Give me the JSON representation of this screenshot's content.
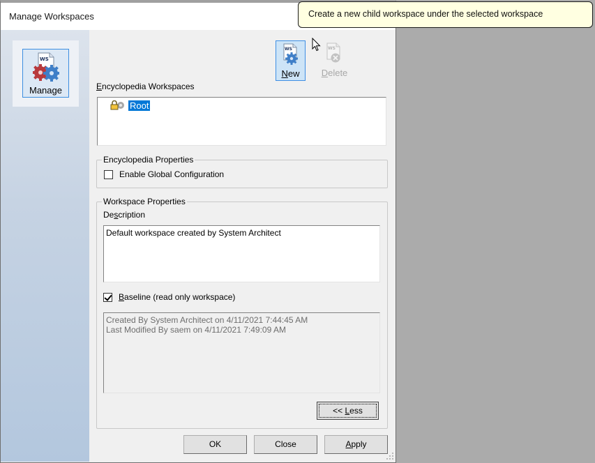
{
  "window": {
    "title": "Manage Workspaces"
  },
  "sidebar": {
    "items": [
      {
        "label": "Manage",
        "icon": "workspace-manage-icon",
        "selected": true
      }
    ]
  },
  "toolbar": {
    "new_label": "New",
    "new_mnemonic": "N",
    "new_rest": "ew",
    "delete_label": "Delete",
    "delete_mnemonic": "D",
    "delete_rest": "elete",
    "delete_enabled": false
  },
  "tooltip": {
    "text": "Create a new child workspace under the selected workspace"
  },
  "workspaces": {
    "label": "Encyclopedia Workspaces",
    "label_mnemonic": "E",
    "label_rest": "ncyclopedia Workspaces",
    "items": [
      {
        "label": "Root",
        "icon": "locked-workspace-icon",
        "selected": true
      }
    ]
  },
  "encyclopedia_properties": {
    "title": "Encyclopedia Properties",
    "enable_global_config_label": "Enable Global Configuration",
    "enable_global_config_checked": false
  },
  "workspace_properties": {
    "title": "Workspace Properties",
    "description_label": "Description",
    "description_pre": "De",
    "description_mnemonic": "s",
    "description_post": "cription",
    "description_value": "Default workspace created by System Architect",
    "baseline_label": "Baseline (read only workspace)",
    "baseline_mnemonic": "B",
    "baseline_rest": "aseline (read only workspace)",
    "baseline_checked": true,
    "info_lines": [
      "Created By System Architect on 4/11/2021 7:44:45 AM",
      "Last Modified By saem on 4/11/2021 7:49:09 AM"
    ],
    "less_button": "<< Less",
    "less_pre": "<< ",
    "less_mnemonic": "L",
    "less_post": "ess"
  },
  "footer": {
    "ok_label": "OK",
    "close_label": "Close",
    "apply_label": "Apply",
    "apply_mnemonic": "A",
    "apply_rest": "pply"
  }
}
